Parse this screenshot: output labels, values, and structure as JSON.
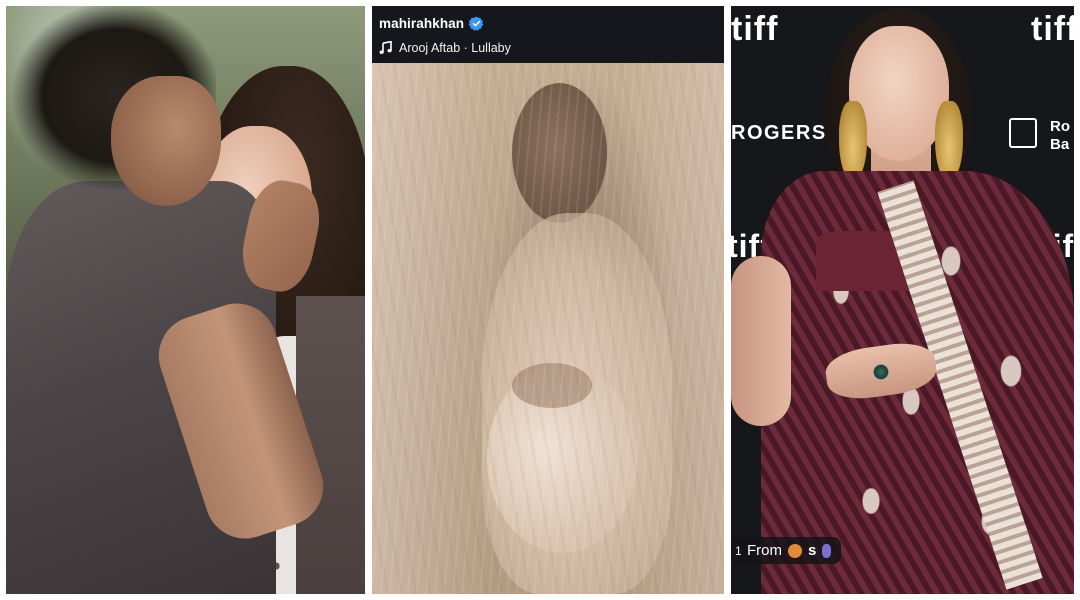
{
  "story": {
    "username": "mahirahkhan",
    "music": "Arooj Aftab · Lullaby"
  },
  "backdrop": {
    "logo": "tiff",
    "sponsor_rogers": "ROGERS",
    "sponsor_rbc_line1": "Ro",
    "sponsor_rbc_line2": "Ba"
  },
  "overlay": {
    "cut_text": "1",
    "from_label": "From",
    "sender_text": "s"
  },
  "colors": {
    "verified_badge": "#3897f0",
    "story_header_bg": "#15171c",
    "backdrop_bg": "#15171b",
    "saree": "#5a1f2e",
    "blouse": "#6a2434"
  },
  "icons": {
    "verified": "verified-badge-icon",
    "music": "music-note-icon"
  }
}
